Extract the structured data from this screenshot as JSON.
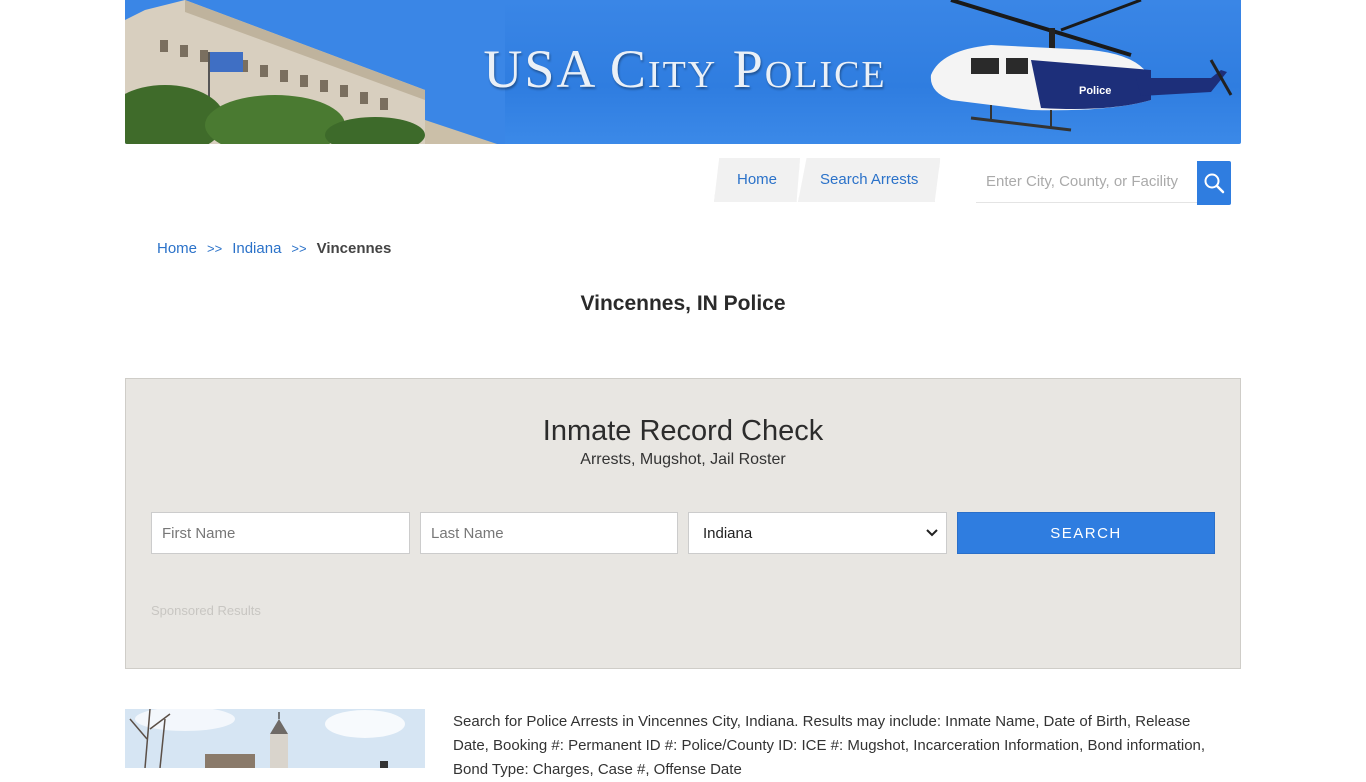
{
  "banner": {
    "title": "USA City Police",
    "heli_label": "Police"
  },
  "nav": {
    "items": [
      {
        "label": "Home"
      },
      {
        "label": "Search Arrests"
      }
    ]
  },
  "search": {
    "placeholder": "Enter City, County, or Facility"
  },
  "breadcrumb": {
    "home": "Home",
    "sep": ">>",
    "state": "Indiana",
    "current": "Vincennes"
  },
  "page": {
    "title": "Vincennes, IN Police"
  },
  "record_check": {
    "title": "Inmate Record Check",
    "subtitle": "Arrests, Mugshot, Jail Roster",
    "first_placeholder": "First Name",
    "last_placeholder": "Last Name",
    "state_value": "Indiana",
    "search_label": "SEARCH",
    "sponsored": "Sponsored Results"
  },
  "content": {
    "description": "Search for Police Arrests in Vincennes City, Indiana. Results may include: Inmate Name, Date of Birth, Release Date, Booking #: Permanent ID #: Police/County ID: ICE #: Mugshot, Incarceration Information, Bond information, Bond Type: Charges, Case #, Offense Date"
  },
  "colors": {
    "accent": "#2f7de0",
    "link": "#2b72c9",
    "panel": "#e8e6e2"
  }
}
